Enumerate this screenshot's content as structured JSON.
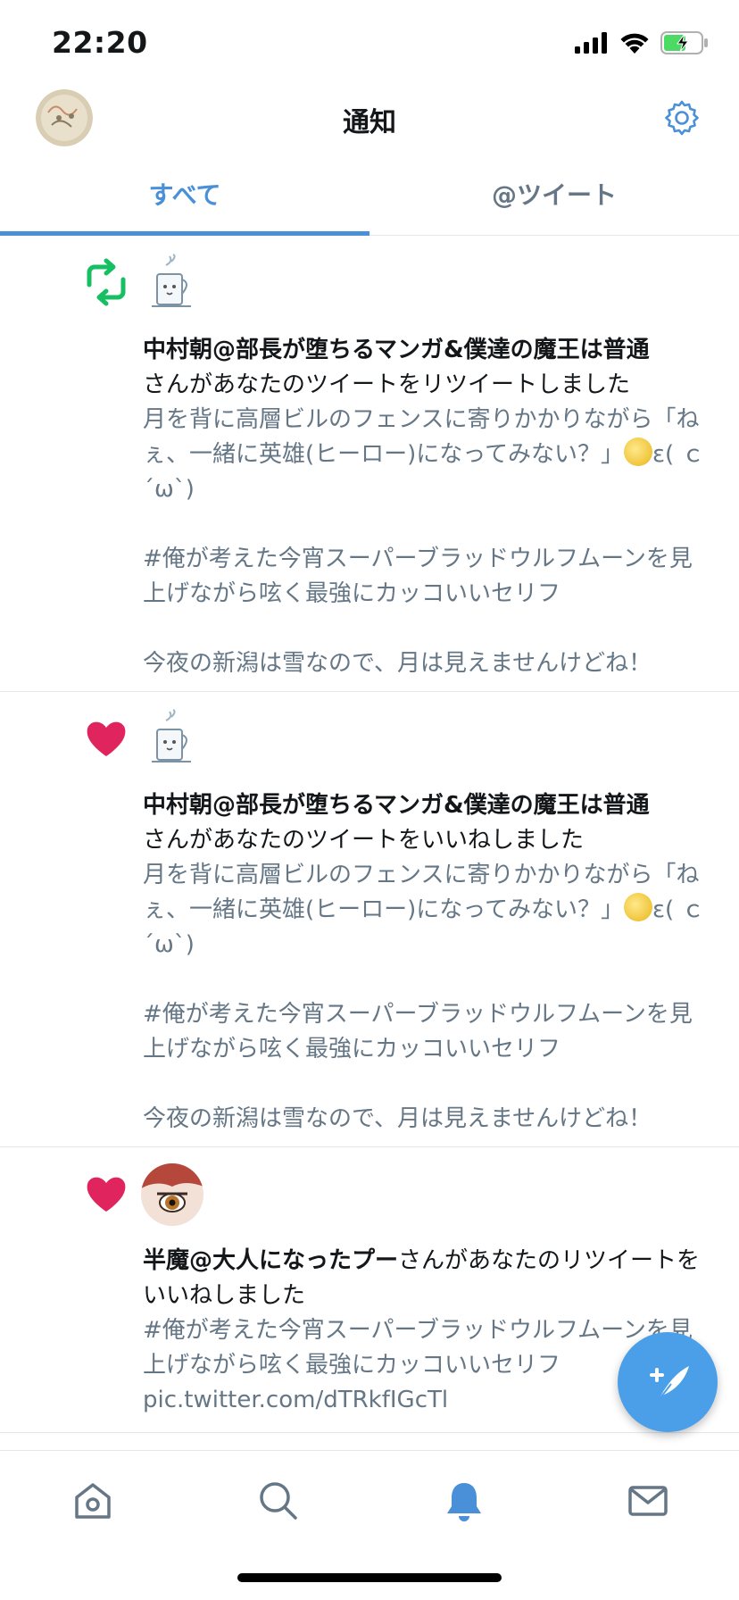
{
  "status_bar": {
    "time": "22:20"
  },
  "header": {
    "title": "通知"
  },
  "tabs": [
    {
      "label": "すべて",
      "active": true
    },
    {
      "label": "@ツイート",
      "active": false
    }
  ],
  "notifications": [
    {
      "type": "retweet",
      "user_name": "中村朝@部長が堕ちるマンガ&僕達の魔王は普通",
      "action": "さんがあなたのツイートをリツイートしました",
      "snippet_part1": "月を背に高層ビルのフェンスに寄りかかりながら「ねぇ、一緒に英雄(ヒーロー)になってみない？」",
      "snippet_part2": "ε( ｃ´ω`)\n\n#俺が考えた今宵スーパーブラッドウルフムーンを見上げながら呟く最強にカッコいいセリフ\n\n今夜の新潟は雪なので、月は見えませんけどね！"
    },
    {
      "type": "like",
      "user_name": "中村朝@部長が堕ちるマンガ&僕達の魔王は普通",
      "action": "さんがあなたのツイートをいいねしました",
      "snippet_part1": "月を背に高層ビルのフェンスに寄りかかりながら「ねぇ、一緒に英雄(ヒーロー)になってみない？」",
      "snippet_part2": "ε( ｃ´ω`)\n\n#俺が考えた今宵スーパーブラッドウルフムーンを見上げながら呟く最強にカッコいいセリフ\n\n今夜の新潟は雪なので、月は見えませんけどね！"
    },
    {
      "type": "like",
      "user_name": "半魔@大人になったプー",
      "action": "さんがあなたのリツイートをいいねしました",
      "snippet": "#俺が考えた今宵スーパーブラッドウルフムーンを見上げながら呟く最強にカッコいいセリフ\npic.twitter.com/dTRkfIGcTl"
    }
  ],
  "colors": {
    "accent": "#4a90d9",
    "retweet": "#17bf63",
    "like": "#e0245e",
    "secondary_text": "#657786"
  },
  "icons": {
    "settings": "gear-icon",
    "compose": "compose-tweet-icon",
    "nav": [
      "home-icon",
      "search-icon",
      "bell-icon",
      "mail-icon"
    ]
  }
}
